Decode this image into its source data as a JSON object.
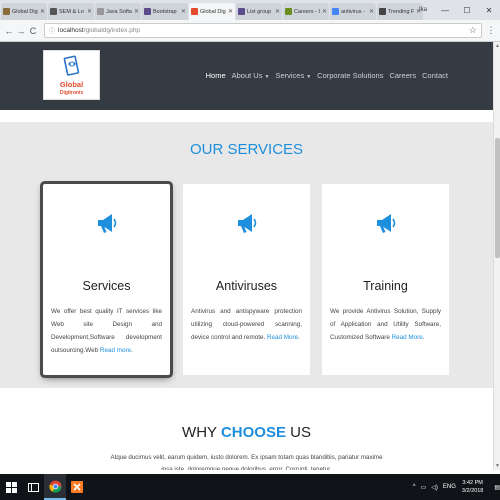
{
  "browser": {
    "tabs": [
      {
        "label": "Global Digi",
        "color": "#8a6d3b",
        "active": false
      },
      {
        "label": "SEM & Lo",
        "color": "#555555",
        "active": false
      },
      {
        "label": "Java Softw",
        "color": "#999999",
        "active": false
      },
      {
        "label": "Bootstrap",
        "color": "#5b4b8a",
        "active": false
      },
      {
        "label": "Global Digi",
        "color": "#e34b2f",
        "active": true
      },
      {
        "label": "List group",
        "color": "#5b4b8a",
        "active": false
      },
      {
        "label": "Careers - G",
        "color": "#6b8e23",
        "active": false
      },
      {
        "label": "antivirus -",
        "color": "#4285f4",
        "active": false
      },
      {
        "label": "Trending F",
        "color": "#444444",
        "active": false
      }
    ],
    "tab_close": "✕",
    "window_controls": {
      "user": "Ika",
      "minimize": "—",
      "maximize": "☐",
      "close": "✕"
    },
    "address": {
      "host": "localhost",
      "path": "/globaldg/index.php"
    },
    "nav_back": "←",
    "nav_forward": "→",
    "nav_reload": "C",
    "star_icon": "☆",
    "menu_icon": "⋮"
  },
  "site": {
    "logo": {
      "line1": "Global",
      "line2": "Digitronix"
    },
    "nav": [
      {
        "label": "Home",
        "active": true,
        "dropdown": false
      },
      {
        "label": "About Us",
        "active": false,
        "dropdown": true
      },
      {
        "label": "Services",
        "active": false,
        "dropdown": true
      },
      {
        "label": "Corporate Solutions",
        "active": false,
        "dropdown": false
      },
      {
        "label": "Careers",
        "active": false,
        "dropdown": false
      },
      {
        "label": "Contact",
        "active": false,
        "dropdown": false
      }
    ],
    "services": {
      "title": "OUR SERVICES",
      "cards": [
        {
          "title": "Services",
          "desc": "We offer best quality IT services like Web site Design and Development,Software development outsourcing.Web ",
          "link": "Read more",
          "after_link": ".",
          "icon": "megaphone-icon"
        },
        {
          "title": "Antiviruses",
          "desc": "Antivirus and antispyware protection utilizing cloud-powered scanning, device control and remote. ",
          "link": "Read More",
          "after_link": ".",
          "icon": "megaphone-icon"
        },
        {
          "title": "Training",
          "desc": "We provide Antivirus Solution, Supply of Application and Utility Software, Customized Software ",
          "link": "Read More",
          "after_link": ".",
          "icon": "megaphone-icon"
        }
      ]
    },
    "why": {
      "title_plain": "WHY",
      "title_highlight": "CHOOSE",
      "title_end": "US",
      "text": "Atque ducimus velit, earum quidem, iusto dolorem. Ex ipsam totam quas blanditiis, pariatur maxime ipsa iste, doloremque neque doloribus, error. Corrupti, tenetur."
    }
  },
  "taskbar": {
    "time": "3:42 PM",
    "date": "3/2/2018",
    "tray_up": "^",
    "lang": "ENG"
  },
  "colors": {
    "accent": "#1e8fdc",
    "header_bg": "#353b43",
    "section_bg": "#e8e8e8",
    "logo_red": "#e34b2f"
  }
}
